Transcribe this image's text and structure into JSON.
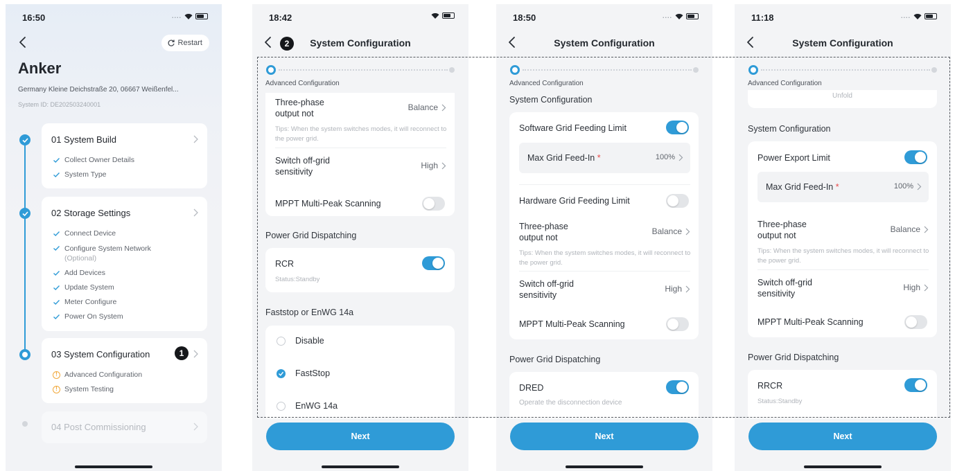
{
  "phone1": {
    "time": "16:50",
    "restart_label": "Restart",
    "brand": "Anker",
    "address": "Germany Kleine Deichstraße 20, 06667 Weißenfel...",
    "system_id": "System ID: DE202503240001",
    "steps": [
      {
        "title": "01 System Build",
        "items": [
          "Collect Owner Details",
          "System Type"
        ]
      },
      {
        "title": "02 Storage Settings",
        "items": [
          "Connect Device",
          "Configure System Network",
          "(Optional)",
          "Add Devices",
          "Update System",
          "Meter Configure",
          "Power On System"
        ]
      },
      {
        "title": "03 System Configuration",
        "items": [
          "Advanced Configuration",
          "System Testing"
        ]
      },
      {
        "title": "04 Post Commissioning",
        "items": []
      }
    ],
    "badge": "1"
  },
  "phone2": {
    "time": "18:42",
    "title": "System Configuration",
    "badge": "2",
    "progress_label": "Advanced Configuration",
    "three_phase_label_1": "Three-phase",
    "three_phase_label_2": "output not",
    "three_phase_value": "Balance",
    "tips": "Tips: When the system switches modes, it will reconnect to the power grid.",
    "switch_offgrid_1": "Switch off-grid",
    "switch_offgrid_2": "sensitivity",
    "switch_offgrid_value": "High",
    "mppt_label": "MPPT Multi-Peak Scanning",
    "power_grid_title": "Power Grid Dispatching",
    "rcr_label": "RCR",
    "rcr_status": "Status:Standby",
    "faststop_title": "Faststop or EnWG 14a",
    "radio_options": [
      "Disable",
      "FastStop",
      "EnWG 14a"
    ],
    "next_label": "Next"
  },
  "phone3": {
    "time": "18:50",
    "title": "System Configuration",
    "progress_label": "Advanced Configuration",
    "section_title": "System Configuration",
    "software_limit_label": "Software Grid Feeding Limit",
    "max_feed_label": "Max Grid Feed-In",
    "max_feed_value": "100%",
    "hardware_limit_label": "Hardware Grid Feeding Limit",
    "three_phase_label_1": "Three-phase",
    "three_phase_label_2": "output not",
    "three_phase_value": "Balance",
    "tips": "Tips: When the system switches modes, it will reconnect to the power grid.",
    "switch_offgrid_1": "Switch off-grid",
    "switch_offgrid_2": "sensitivity",
    "switch_offgrid_value": "High",
    "mppt_label": "MPPT Multi-Peak Scanning",
    "power_grid_title": "Power Grid Dispatching",
    "dred_label": "DRED",
    "dred_desc": "Operate the disconnection device",
    "next_label": "Next"
  },
  "phone4": {
    "time": "11:18",
    "title": "System Configuration",
    "progress_label": "Advanced Configuration",
    "cut_text": "Unfold",
    "section_title": "System Configuration",
    "power_export_label": "Power Export Limit",
    "max_feed_label": "Max Grid Feed-In",
    "max_feed_value": "100%",
    "three_phase_label_1": "Three-phase",
    "three_phase_label_2": "output not",
    "three_phase_value": "Balance",
    "tips": "Tips: When the system switches modes, it will reconnect to the power grid.",
    "switch_offgrid_1": "Switch off-grid",
    "switch_offgrid_2": "sensitivity",
    "switch_offgrid_value": "High",
    "mppt_label": "MPPT Multi-Peak Scanning",
    "power_grid_title": "Power Grid Dispatching",
    "rrcr_label": "RRCR",
    "rrcr_status": "Status:Standby",
    "next_label": "Next"
  },
  "colors": {
    "accent": "#2f9bd7",
    "warning": "#f1a83a",
    "required": "#e84a4a"
  },
  "icons": [
    "back-arrow-icon",
    "restart-icon",
    "check-icon",
    "warning-icon",
    "chevron-right-icon",
    "wifi-icon",
    "battery-icon"
  ]
}
